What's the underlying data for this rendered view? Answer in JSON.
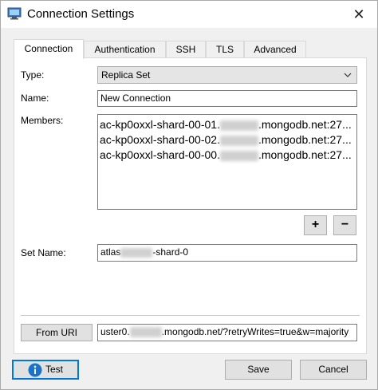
{
  "window": {
    "title": "Connection Settings",
    "close_glyph": "✕"
  },
  "tabs": [
    {
      "label": "Connection",
      "active": true
    },
    {
      "label": "Authentication",
      "active": false
    },
    {
      "label": "SSH",
      "active": false
    },
    {
      "label": "TLS",
      "active": false
    },
    {
      "label": "Advanced",
      "active": false
    }
  ],
  "form": {
    "type_label": "Type:",
    "type_value": "Replica Set",
    "name_label": "Name:",
    "name_value": "New Connection",
    "members_label": "Members:",
    "members": [
      {
        "prefix": "ac-kp0oxxl-shard-00-01.",
        "suffix": ".mongodb.net:27..."
      },
      {
        "prefix": "ac-kp0oxxl-shard-00-02.",
        "suffix": ".mongodb.net:27..."
      },
      {
        "prefix": "ac-kp0oxxl-shard-00-00.",
        "suffix": ".mongodb.net:27..."
      }
    ],
    "add_label": "+",
    "remove_label": "−",
    "setname_label": "Set Name:",
    "setname_prefix": "atlas",
    "setname_suffix": "-shard-0",
    "from_uri_label": "From URI",
    "uri_prefix": "uster0.",
    "uri_suffix": ".mongodb.net/?retryWrites=true&w=majority"
  },
  "footer": {
    "test_label": "Test",
    "save_label": "Save",
    "cancel_label": "Cancel"
  },
  "colors": {
    "accent": "#0078d7",
    "info_icon": "#1a73c8"
  },
  "icons": {
    "app": "monitor-icon",
    "combo_arrow": "chevron-down-icon",
    "test": "info-icon"
  }
}
